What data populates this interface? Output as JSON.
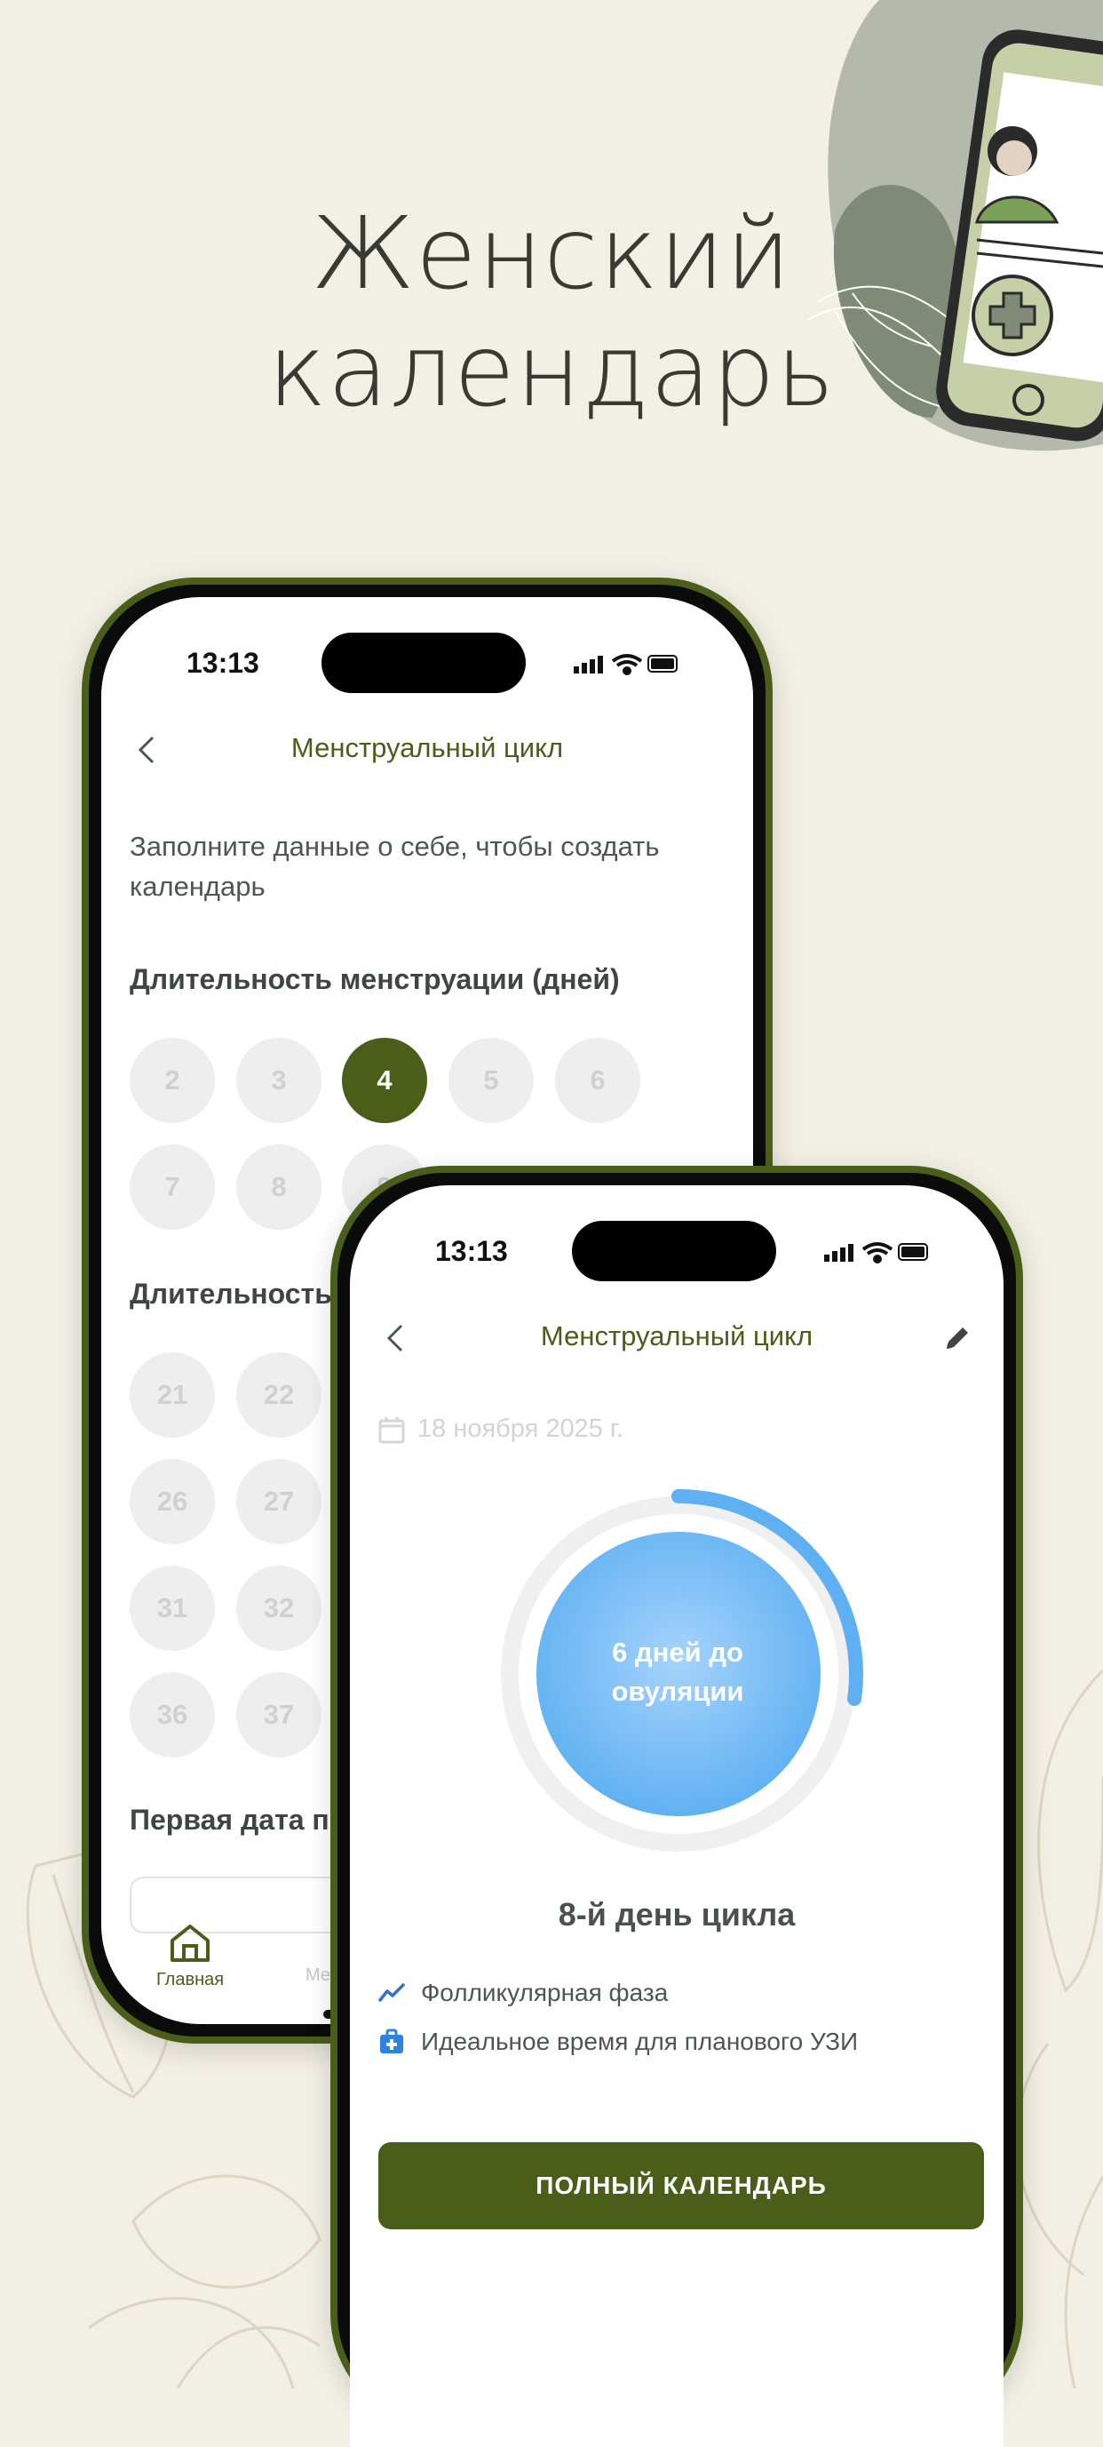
{
  "headline": {
    "line1": "Женский",
    "line2": "календарь"
  },
  "colors": {
    "background": "#f2efe4",
    "brand": "#4a5e1a",
    "accent_blue": "#5fb0f2",
    "chip_bg": "#eeeeee"
  },
  "phone1": {
    "status": {
      "time": "13:13"
    },
    "nav": {
      "title": "Менструальный цикл",
      "back_icon": "chevron-left-icon"
    },
    "intro": "Заполните данные о себе, чтобы создать календарь",
    "menstruation": {
      "title": "Длительность менструации (дней)",
      "options": [
        "2",
        "3",
        "4",
        "5",
        "6",
        "7",
        "8",
        "9"
      ],
      "selected": "4"
    },
    "cycle": {
      "title_visible": "Длительность",
      "options": [
        "21",
        "22",
        "26",
        "27",
        "31",
        "32",
        "36",
        "37"
      ]
    },
    "first_date": {
      "title_visible": "Первая дата п"
    },
    "tabbar": {
      "home_label": "Главная",
      "second_label_visible": "Ме"
    }
  },
  "phone2": {
    "status": {
      "time": "13:13"
    },
    "nav": {
      "title": "Менструальный цикл",
      "back_icon": "chevron-left-icon",
      "edit_icon": "pencil-icon"
    },
    "date": "18 ноября 2025 г.",
    "ring": {
      "label_line1": "6 дней до",
      "label_line2": "овуляции"
    },
    "cycle_day": "8-й день цикла",
    "phase": {
      "icon": "trend-line-icon",
      "text": "Фолликулярная фаза"
    },
    "tip": {
      "icon": "medical-kit-icon",
      "text": "Идеальное время для планового УЗИ"
    },
    "cta_label": "ПОЛНЫЙ КАЛЕНДАРЬ"
  }
}
